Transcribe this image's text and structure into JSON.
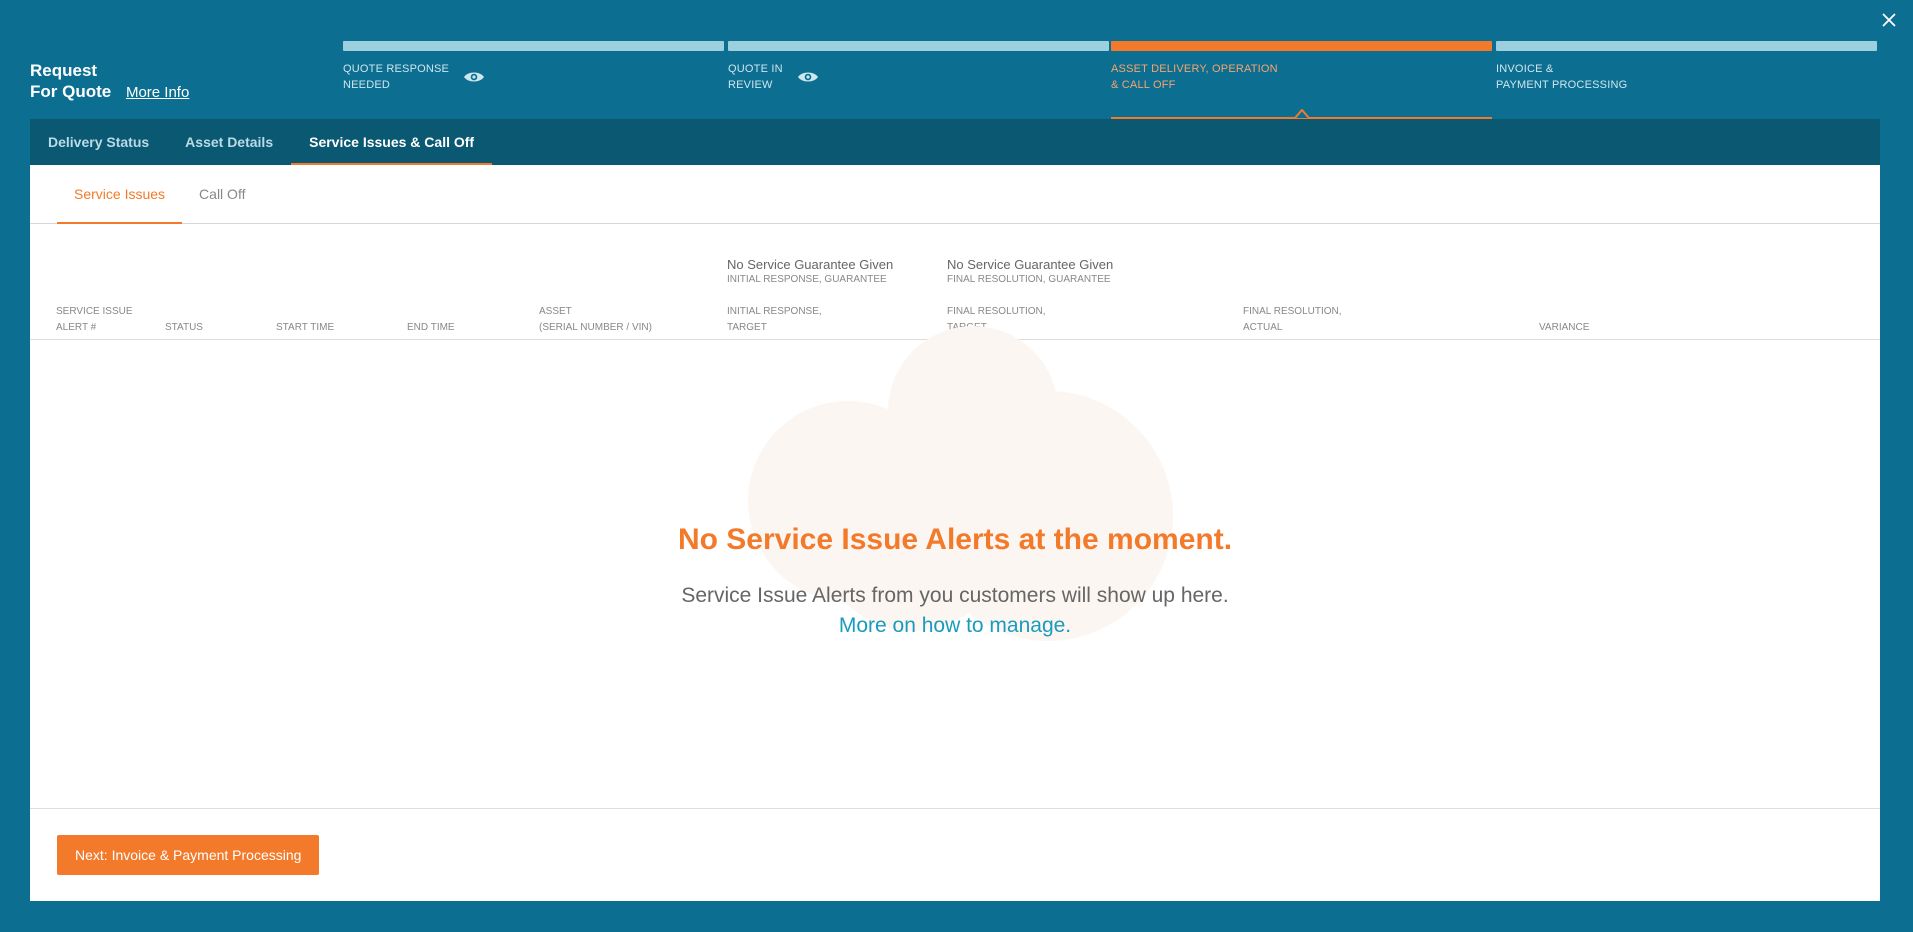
{
  "header": {
    "title_line1": "Request",
    "title_line2": "For Quote",
    "more_info": "More Info",
    "close_icon": "close-icon"
  },
  "steps": [
    {
      "label": "QUOTE RESPONSE\nNEEDED",
      "has_eye": true,
      "active": false
    },
    {
      "label": "QUOTE IN\nREVIEW",
      "has_eye": true,
      "active": false
    },
    {
      "label": "ASSET DELIVERY, OPERATION\n& CALL OFF",
      "has_eye": false,
      "active": true
    },
    {
      "label": "INVOICE &\nPAYMENT PROCESSING",
      "has_eye": false,
      "active": false
    }
  ],
  "tabs": [
    {
      "label": "Delivery Status",
      "active": false
    },
    {
      "label": "Asset Details",
      "active": false
    },
    {
      "label": "Service Issues & Call Off",
      "active": true
    }
  ],
  "subtabs": [
    {
      "label": "Service Issues",
      "active": true
    },
    {
      "label": "Call Off",
      "active": false
    }
  ],
  "guarantees": {
    "initial": {
      "value": "No Service Guarantee Given",
      "label": "INITIAL RESPONSE, GUARANTEE"
    },
    "final": {
      "value": "No Service Guarantee Given",
      "label": "FINAL RESOLUTION, GUARANTEE"
    }
  },
  "columns": [
    "SERVICE ISSUE\nALERT #",
    "STATUS",
    "START TIME",
    "END TIME",
    "ASSET\n(SERIAL NUMBER / VIN)",
    "INITIAL RESPONSE,\nTARGET",
    "FINAL RESOLUTION,\nTARGET",
    "FINAL RESOLUTION,\nACTUAL",
    "VARIANCE"
  ],
  "empty_state": {
    "title": "No Service Issue Alerts at the moment.",
    "description": "Service Issue Alerts from you customers will show up here.",
    "link": "More on how to manage."
  },
  "footer": {
    "next_button": "Next: Invoice & Payment Processing"
  },
  "colors": {
    "background": "#0c6f91",
    "tabbar": "#0a5872",
    "accent": "#f37a2a",
    "link": "#1a9bbd",
    "step_bar": "#9dd0df",
    "cloud": "#fbf6f1"
  }
}
